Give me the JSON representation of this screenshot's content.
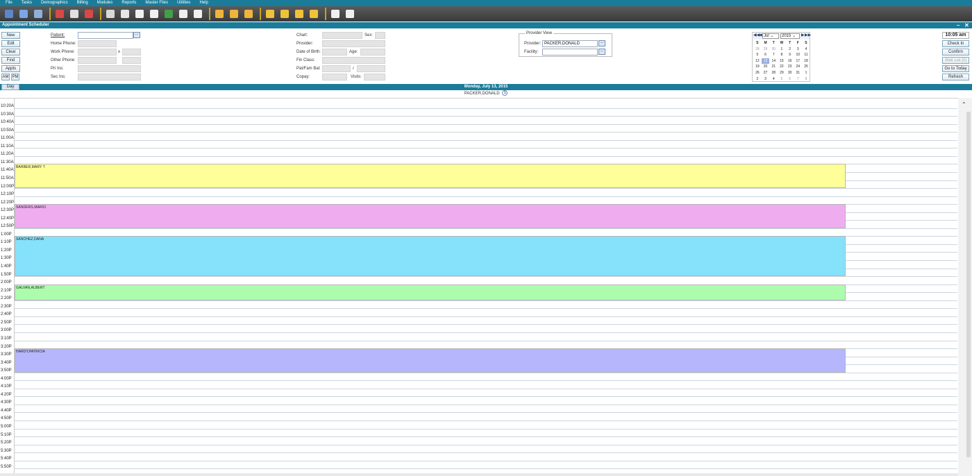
{
  "menu": [
    "File",
    "Tasks",
    "Demographics",
    "Billing",
    "Modules",
    "Reports",
    "Master Files",
    "Utilities",
    "Help"
  ],
  "toolbar_icons": [
    {
      "name": "patient-icon",
      "color": "#5c86c9"
    },
    {
      "name": "folder-icon",
      "color": "#7aa7e6"
    },
    {
      "name": "user-group-icon",
      "color": "#8fb0d8"
    },
    {
      "name": "calendar-icon",
      "color": "#d94848"
    },
    {
      "name": "hand-icon",
      "color": "#e0e0e0"
    },
    {
      "name": "user-remove-icon",
      "color": "#d94848"
    },
    {
      "name": "grid-icon",
      "color": "#d8d8d8"
    },
    {
      "name": "ledger-icon",
      "color": "#e6e6e6"
    },
    {
      "name": "upload-icon",
      "color": "#f0f0f0"
    },
    {
      "name": "download-icon",
      "color": "#f0f0f0"
    },
    {
      "name": "money-icon",
      "color": "#3fa04a"
    },
    {
      "name": "clock-icon",
      "color": "#f0f0f0"
    },
    {
      "name": "search-doc-icon",
      "color": "#f0f0f0"
    },
    {
      "name": "note-icon",
      "color": "#f0b43a"
    },
    {
      "name": "magnify-icon",
      "color": "#f0b43a"
    },
    {
      "name": "tools-icon",
      "color": "#f0b43a"
    },
    {
      "name": "bar-chart-icon",
      "color": "#f0c23a"
    },
    {
      "name": "chart-search-icon",
      "color": "#f0c23a"
    },
    {
      "name": "line-chart-icon",
      "color": "#f0c23a"
    },
    {
      "name": "easel-icon",
      "color": "#f0c23a"
    },
    {
      "name": "documents-icon",
      "color": "#f0f0f0"
    },
    {
      "name": "hammer-icon",
      "color": "#f0f0f0"
    }
  ],
  "window": {
    "title": "Appointment Scheduler",
    "minimize": "–",
    "close": "✕"
  },
  "left_buttons": {
    "new": "New",
    "edit": "Edit",
    "clear": "Clear",
    "find": "Find",
    "appts": "Appts",
    "am": "AM",
    "pm": "PM",
    "day": "Day"
  },
  "patient_form": {
    "patient": "Patient:",
    "home_phone": "Home Phone:",
    "work_phone": "Work Phone:",
    "ext": "x",
    "other_phone": "Other Phone:",
    "pri_ins": "Pri Ins:",
    "sec_ins": "Sec Ins:"
  },
  "chart_form": {
    "chart": "Chart:",
    "sex": "Sex:",
    "provider": "Provider:",
    "dob": "Date of Birth:",
    "age": "Age:",
    "fin_class": "Fin Class:",
    "pat_fam_bal": "Pat/Fam Bal:",
    "slash": "/",
    "copay": "Copay:",
    "visits": "Visits:"
  },
  "provider_view": {
    "legend": "Provider View",
    "provider_label": "Provider:",
    "provider_value": "PACKER,DONALD",
    "facility_label": "Facility:",
    "facility_value": ""
  },
  "ellipsis": "...",
  "calendar": {
    "month": "Jul",
    "year": "2015",
    "nav_first": "◀◀",
    "nav_prev": "◀",
    "nav_next": "▶",
    "nav_last": "▶▶",
    "weekdays": [
      "S",
      "M",
      "T",
      "W",
      "T",
      "F",
      "S"
    ],
    "days": [
      "28",
      "29",
      "30",
      "1",
      "2",
      "3",
      "4",
      "5",
      "6",
      "7",
      "8",
      "9",
      "10",
      "11",
      "12",
      "13",
      "14",
      "15",
      "16",
      "17",
      "18",
      "19",
      "20",
      "21",
      "22",
      "23",
      "24",
      "25",
      "26",
      "27",
      "28",
      "29",
      "30",
      "31",
      "1",
      "2",
      "3",
      "4",
      "5",
      "6",
      "7",
      "8"
    ],
    "selected_index": 15,
    "gray_indices": [
      0,
      1,
      2,
      38,
      39,
      40,
      41
    ]
  },
  "right_panel": {
    "time": "10:05 am",
    "check_in": "Check In",
    "confirm": "Confirm",
    "wait_list": "Wait List [0]",
    "go_to_today": "Go to Today",
    "refresh": "Refresh"
  },
  "schedule": {
    "date_label": "Monday, July 13, 2015",
    "provider": "PACKER,DONALD",
    "provider_badge": "S",
    "times": [
      "10:20A",
      "10:30A",
      "10:40A",
      "10:50A",
      "11:00A",
      "11:10A",
      "11:20A",
      "11:30A",
      "11:40A",
      "11:50A",
      "12:00P",
      "12:10P",
      "12:20P",
      "12:30P",
      "12:40P",
      "12:50P",
      "1:00P",
      "1:10P",
      "1:20P",
      "1:30P",
      "1:40P",
      "1:50P",
      "2:00P",
      "2:10P",
      "2:20P",
      "2:30P",
      "2:40P",
      "2:50P",
      "3:00P",
      "3:10P",
      "3:20P",
      "3:30P",
      "3:40P",
      "3:50P",
      "4:00P",
      "4:10P",
      "4:20P",
      "4:30P",
      "4:40P",
      "4:50P",
      "5:00P",
      "5:10P",
      "5:20P",
      "5:30P",
      "5:40P",
      "5:50P"
    ],
    "appointments": [
      {
        "patient": "BARBER,MARY T",
        "start": "11:40A",
        "slots": 3,
        "color": "#ffff99"
      },
      {
        "patient": "SANDERS,MARIO",
        "start": "12:30P",
        "slots": 3,
        "color": "#efadef"
      },
      {
        "patient": "SANCHEZ,DANA",
        "start": "1:10P",
        "slots": 5,
        "color": "#86e1fa"
      },
      {
        "patient": "GALVAN,ALBERT",
        "start": "2:10P",
        "slots": 2,
        "color": "#adfcad"
      },
      {
        "patient": "HARDY,PATRICIA",
        "start": "3:30P",
        "slots": 3,
        "color": "#b6b6fd"
      }
    ],
    "scroll_up": "⌃",
    "scroll_down": "⌄"
  }
}
